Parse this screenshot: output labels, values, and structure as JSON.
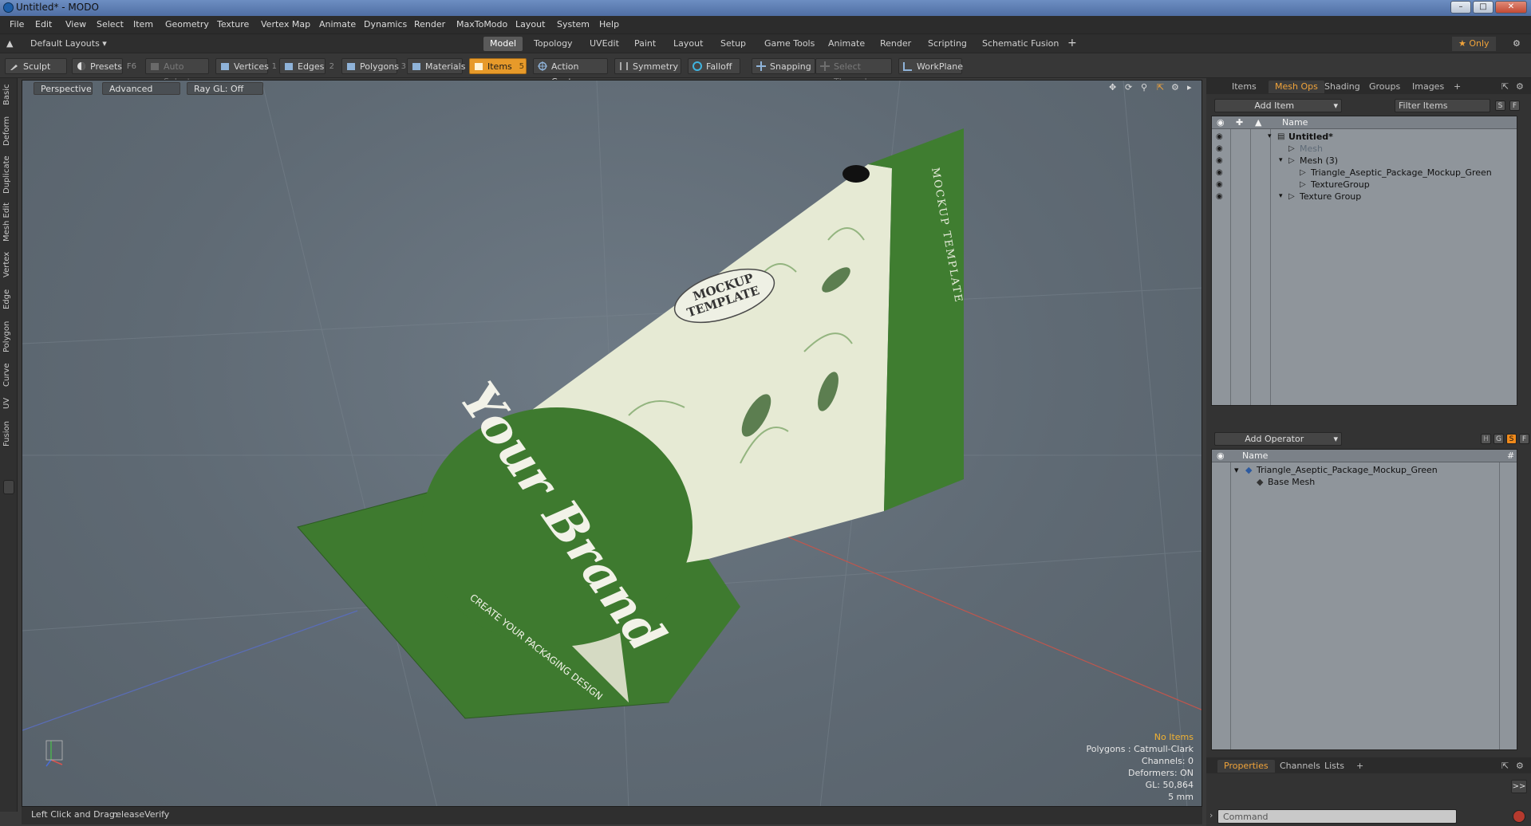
{
  "window": {
    "title": "Untitled* - MODO"
  },
  "menu": [
    "File",
    "Edit",
    "View",
    "Select",
    "Item",
    "Geometry",
    "Texture",
    "Vertex Map",
    "Animate",
    "Dynamics",
    "Render",
    "MaxToModo",
    "Layout",
    "System",
    "Help"
  ],
  "layoutbar": {
    "layout_label": "Default Layouts ▾",
    "tabs": [
      "Model",
      "Topology",
      "UVEdit",
      "Paint",
      "Layout",
      "Setup",
      "Game Tools",
      "Animate",
      "Render",
      "Scripting",
      "Schematic Fusion"
    ],
    "active_tab": "Model",
    "add": "+",
    "only": "★ Only"
  },
  "toolbar": {
    "sculpt": "Sculpt",
    "presets": "Presets",
    "presets_key": "F6",
    "auto_select": "Auto Select",
    "vertices": "Vertices",
    "vertices_key": "1",
    "edges": "Edges",
    "edges_key": "2",
    "polygons": "Polygons",
    "polygons_key": "3",
    "materials": "Materials",
    "items": "Items",
    "items_key": "5",
    "action_center": "Action Center",
    "symmetry": "Symmetry",
    "falloff": "Falloff",
    "snapping": "Snapping",
    "select_through": "Select Through",
    "workplane": "WorkPlane"
  },
  "lefttabs": [
    "Basic",
    "Deform",
    "Duplicate",
    "Mesh Edit",
    "Vertex",
    "Edge",
    "Polygon",
    "Curve",
    "UV",
    "Fusion"
  ],
  "viewport": {
    "perspective": "Perspective",
    "advanced": "Advanced",
    "raygl": "Ray GL: Off",
    "package_brand": "Your Brand",
    "package_tagline": "CREATE YOUR PACKAGING DESIGN",
    "package_badge_1": "MOCKUP",
    "package_badge_2": "TEMPLATE",
    "package_side_text": "MOCKUP TEMPLATE",
    "info": {
      "no_items": "No Items",
      "polygons": "Polygons : Catmull-Clark",
      "channels": "Channels: 0",
      "deformers": "Deformers: ON",
      "gl": "GL: 50,864",
      "scale": "5 mm"
    }
  },
  "statusline": {
    "hint": "Left Click and Drag:",
    "action": "releaseVerify"
  },
  "items_panel": {
    "tabs": [
      "Items",
      "Mesh Ops",
      "Shading",
      "Groups",
      "Images"
    ],
    "active_tab": "Mesh Ops",
    "add_item": "Add Item",
    "filter_items": "Filter Items",
    "s_label": "S",
    "f_label": "F",
    "col_name": "Name",
    "rows": [
      {
        "label": "Untitled*",
        "indent": 0
      },
      {
        "label": "Mesh",
        "indent": 1,
        "dim": true
      },
      {
        "label": "Mesh (3)",
        "indent": 1
      },
      {
        "label": "Triangle_Aseptic_Package_Mockup_Green",
        "indent": 2
      },
      {
        "label": "TextureGroup",
        "indent": 2
      },
      {
        "label": "Texture Group",
        "indent": 1
      }
    ]
  },
  "meshops_panel": {
    "add_operator": "Add Operator",
    "h_label": "H",
    "g_label": "G",
    "s_label": "S",
    "f_label": "F",
    "col_name": "Name",
    "col_hash": "#",
    "rows": [
      {
        "label": "Triangle_Aseptic_Package_Mockup_Green"
      },
      {
        "label": "Base Mesh"
      }
    ]
  },
  "properties_panel": {
    "tabs": [
      "Properties",
      "Channels",
      "Lists"
    ],
    "active_tab": "Properties",
    "expand": ">>",
    "command_placeholder": "Command"
  },
  "colors": {
    "accent": "#f0a33a",
    "package_green": "#3e7a2f",
    "package_cream": "#e6ead4"
  }
}
